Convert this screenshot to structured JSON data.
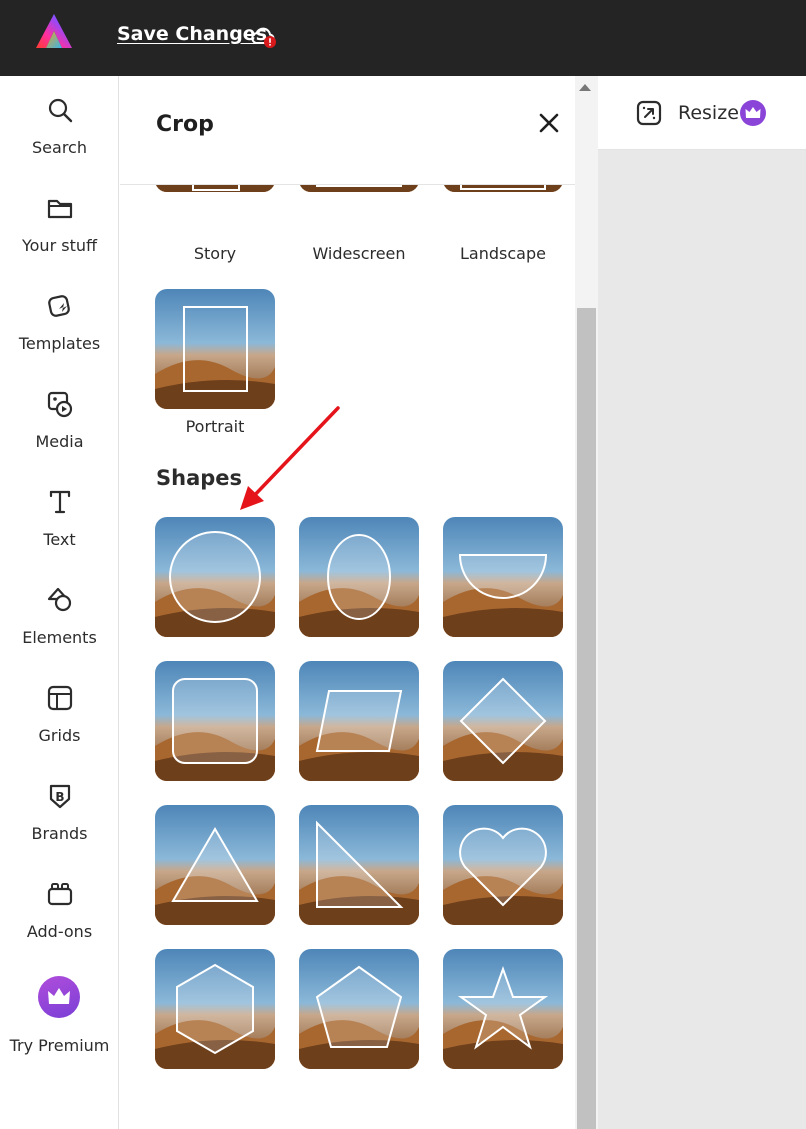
{
  "topbar": {
    "save_label": "Save Changes",
    "logo_icon": "adobe-express-logo",
    "cloud_icon": "cloud-warning-icon"
  },
  "rail": {
    "items": [
      {
        "label": "Search",
        "icon": "search-icon"
      },
      {
        "label": "Your stuff",
        "icon": "folder-icon"
      },
      {
        "label": "Templates",
        "icon": "templates-icon"
      },
      {
        "label": "Media",
        "icon": "media-icon"
      },
      {
        "label": "Text",
        "icon": "text-icon"
      },
      {
        "label": "Elements",
        "icon": "elements-icon"
      },
      {
        "label": "Grids",
        "icon": "grids-icon"
      },
      {
        "label": "Brands",
        "icon": "brands-icon"
      },
      {
        "label": "Add-ons",
        "icon": "add-ons-icon"
      },
      {
        "label": "Try Premium",
        "icon": "premium-crown-icon"
      }
    ]
  },
  "panel": {
    "title": "Crop",
    "aspect_items": [
      {
        "label": "Story"
      },
      {
        "label": "Widescreen"
      },
      {
        "label": "Landscape"
      },
      {
        "label": "Portrait"
      }
    ],
    "shapes_title": "Shapes",
    "shapes": [
      "circle",
      "ellipse",
      "half-circle",
      "rounded-square",
      "parallelogram",
      "diamond",
      "triangle",
      "right-triangle",
      "heart",
      "hexagon",
      "pentagon",
      "star"
    ]
  },
  "right_toolbar": {
    "resize_label": "Resize"
  },
  "colors": {
    "topbar": "#242424",
    "premium": "#8a45d8",
    "annotation_arrow": "#e5141b"
  }
}
